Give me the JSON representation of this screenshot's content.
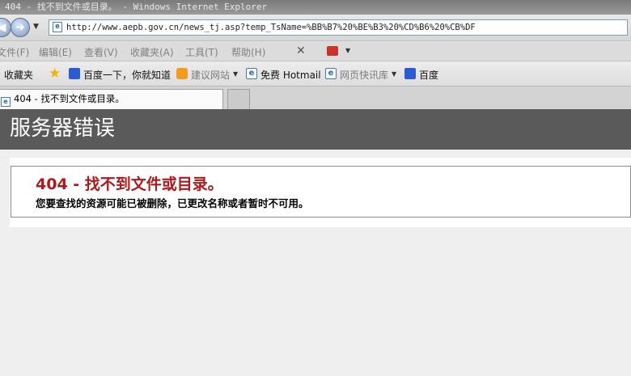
{
  "window": {
    "title": "404 - 找不到文件或目录。 - Windows Internet Explorer"
  },
  "address": {
    "url": "http://www.aepb.gov.cn/news_tj.asp?temp_TsName=%BB%B7%20%BE%B3%20%CD%B6%20%CB%DF"
  },
  "menu": {
    "items": [
      "文件(F)",
      "编辑(E)",
      "查看(V)",
      "收藏夹(A)",
      "工具(T)",
      "帮助(H)"
    ],
    "close": "✕"
  },
  "favorites": {
    "label": "收藏夹",
    "links": [
      "百度一下，你就知道",
      "建议网站",
      "免费 Hotmail",
      "网页快讯库",
      "百度"
    ]
  },
  "tab": {
    "title": "404 - 找不到文件或目录。"
  },
  "page": {
    "header": "服务器错误",
    "error_title": "404 - 找不到文件或目录。",
    "error_message": "您要查找的资源可能已被删除，已更改名称或者暂时不可用。"
  },
  "icons": {
    "back": "arrow-left-icon",
    "forward": "arrow-right-icon",
    "page": "ie-page-icon",
    "favorites_star": "star-icon",
    "baidu": "paw-icon",
    "suggested": "suggested-sites-icon",
    "ie": "ie-icon",
    "translate": "translate-icon"
  },
  "colors": {
    "header_bg": "#5a5a5a",
    "error_red": "#b0191c"
  }
}
